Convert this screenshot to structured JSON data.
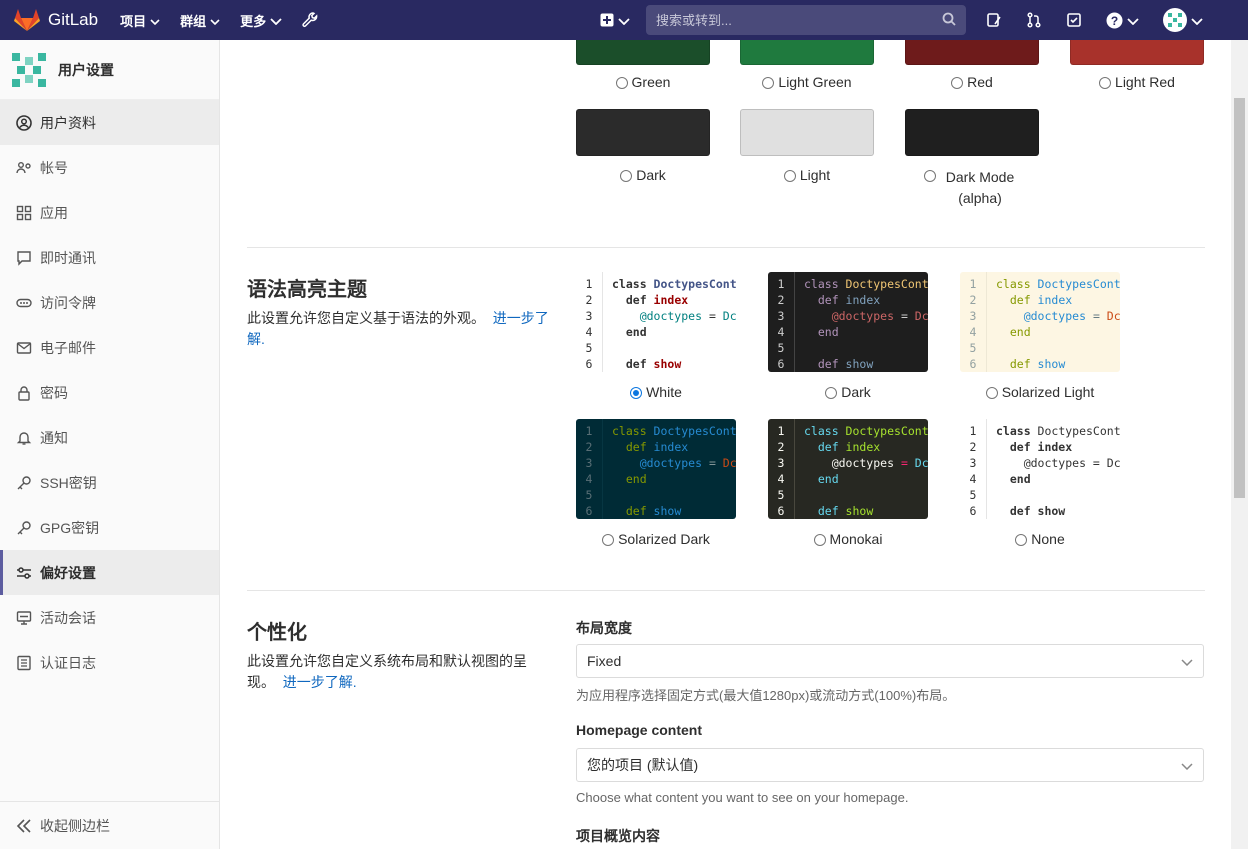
{
  "navbar": {
    "brand": "GitLab",
    "menu": [
      "项目",
      "群组",
      "更多"
    ],
    "search_placeholder": "搜索或转到..."
  },
  "sidebar": {
    "title": "用户设置",
    "items": [
      "用户资料",
      "帐号",
      "应用",
      "即时通讯",
      "访问令牌",
      "电子邮件",
      "密码",
      "通知",
      "SSH密钥",
      "GPG密钥",
      "偏好设置",
      "活动会话",
      "认证日志"
    ],
    "collapse": "收起侧边栏"
  },
  "color_themes": {
    "top_row": [
      "Green",
      "Light Green",
      "Red",
      "Light Red"
    ],
    "second_row": [
      "Dark",
      "Light",
      "Dark Mode (alpha)"
    ],
    "top_colors": [
      "#1b4e2a",
      "#1f7a3e",
      "#6e1b1b",
      "#a8322b"
    ],
    "second_colors": [
      "#2b2b2b",
      "#e0e0e0",
      "#1f1f1f"
    ]
  },
  "syntax": {
    "title": "语法高亮主题",
    "desc": "此设置允许您自定义基于语法的外观。",
    "link": "进一步了解.",
    "code_lines": {
      "l1": "class DoctypesCont",
      "l2": "  def index",
      "l3": "    @doctypes = Dc",
      "l4": "  end",
      "l5": "",
      "l6": "  def show"
    },
    "line_numbers": [
      "1",
      "2",
      "3",
      "4",
      "5",
      "6"
    ],
    "themes": [
      "White",
      "Dark",
      "Solarized Light",
      "Solarized Dark",
      "Monokai",
      "None"
    ],
    "selected": "White"
  },
  "personalization": {
    "title": "个性化",
    "desc": "此设置允许您自定义系统布局和默认视图的呈现。",
    "link": "进一步了解.",
    "layout_label": "布局宽度",
    "layout_value": "Fixed",
    "layout_help": "为应用程序选择固定方式(最大值1280px)或流动方式(100%)布局。",
    "homepage_label": "Homepage content",
    "homepage_value": "您的项目 (默认值)",
    "homepage_help": "Choose what content you want to see on your homepage.",
    "overview_label": "项目概览内容"
  }
}
